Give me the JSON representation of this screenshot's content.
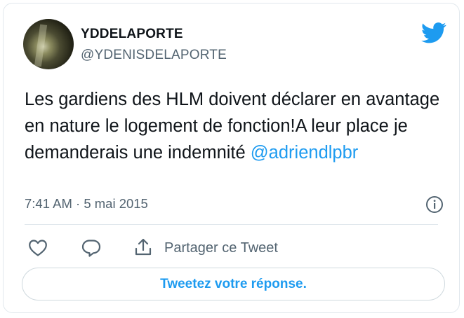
{
  "author": {
    "display_name": "YDDELAPORTE",
    "handle": "@YDENISDELAPORTE"
  },
  "tweet": {
    "text": "Les gardiens des HLM  doivent déclarer en avantage en nature le logement de fonction!A leur place je demanderais une indemnité ",
    "mention": "@adriendlpbr",
    "timestamp": "7:41 AM · 5 mai 2015"
  },
  "actions": {
    "share_label": "Partager ce Tweet",
    "reply_button_label": "Tweetez votre réponse."
  },
  "icons": {
    "brand": "twitter-bird-icon",
    "info": "info-icon",
    "like": "heart-icon",
    "reply": "reply-icon",
    "share": "share-icon"
  },
  "colors": {
    "accent": "#1d9bf0",
    "secondary_text": "#536471",
    "border": "#e1e8ed"
  }
}
